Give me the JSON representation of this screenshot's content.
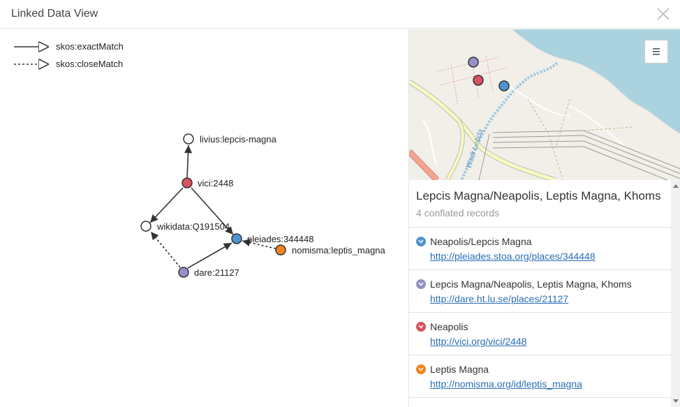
{
  "header": {
    "title": "Linked Data View"
  },
  "legend": [
    {
      "label": "skos:exactMatch",
      "style": "solid"
    },
    {
      "label": "skos:closeMatch",
      "style": "dashed"
    }
  ],
  "graph": {
    "nodes": [
      {
        "id": "livius",
        "label": "livius:lepcis-magna",
        "color": "#ffffff"
      },
      {
        "id": "vici",
        "label": "vici:2448",
        "color": "#d9525e"
      },
      {
        "id": "wikidata",
        "label": "wikidata:Q191504",
        "color": "#ffffff"
      },
      {
        "id": "pleiades",
        "label": "pleiades:344448",
        "color": "#4f93ce"
      },
      {
        "id": "nomisma",
        "label": "nomisma:leptis_magna",
        "color": "#f38320"
      },
      {
        "id": "dare",
        "label": "dare:21127",
        "color": "#9591c7"
      }
    ],
    "links": [
      {
        "from": "vici",
        "to": "livius",
        "type": "exact"
      },
      {
        "from": "vici",
        "to": "wikidata",
        "type": "exact"
      },
      {
        "from": "vici",
        "to": "pleiades",
        "type": "exact"
      },
      {
        "from": "dare",
        "to": "pleiades",
        "type": "exact"
      },
      {
        "from": "dare",
        "to": "wikidata",
        "type": "close"
      },
      {
        "from": "nomisma",
        "to": "pleiades",
        "type": "close"
      }
    ]
  },
  "map": {
    "place_label": "Wadi Lebda",
    "markers": [
      {
        "name": "dare",
        "color": "#9591c7"
      },
      {
        "name": "vici",
        "color": "#d9525e"
      },
      {
        "name": "pleiades",
        "color": "#4f93ce"
      }
    ]
  },
  "panel": {
    "title": "Lepcis Magna/Neapolis, Leptis Magna, Khoms",
    "subtitle": "4 conflated records",
    "records": [
      {
        "name": "Neapolis/Lepcis Magna",
        "url": "http://pleiades.stoa.org/places/344448",
        "color": "#4f93ce"
      },
      {
        "name": "Lepcis Magna/Neapolis, Leptis Magna, Khoms",
        "url": "http://dare.ht.lu.se/places/21127",
        "color": "#9591c7"
      },
      {
        "name": "Neapolis",
        "url": "http://vici.org/vici/2448",
        "color": "#d9525e"
      },
      {
        "name": "Leptis Magna",
        "url": "http://nomisma.org/id/leptis_magna",
        "color": "#f38320"
      }
    ]
  }
}
